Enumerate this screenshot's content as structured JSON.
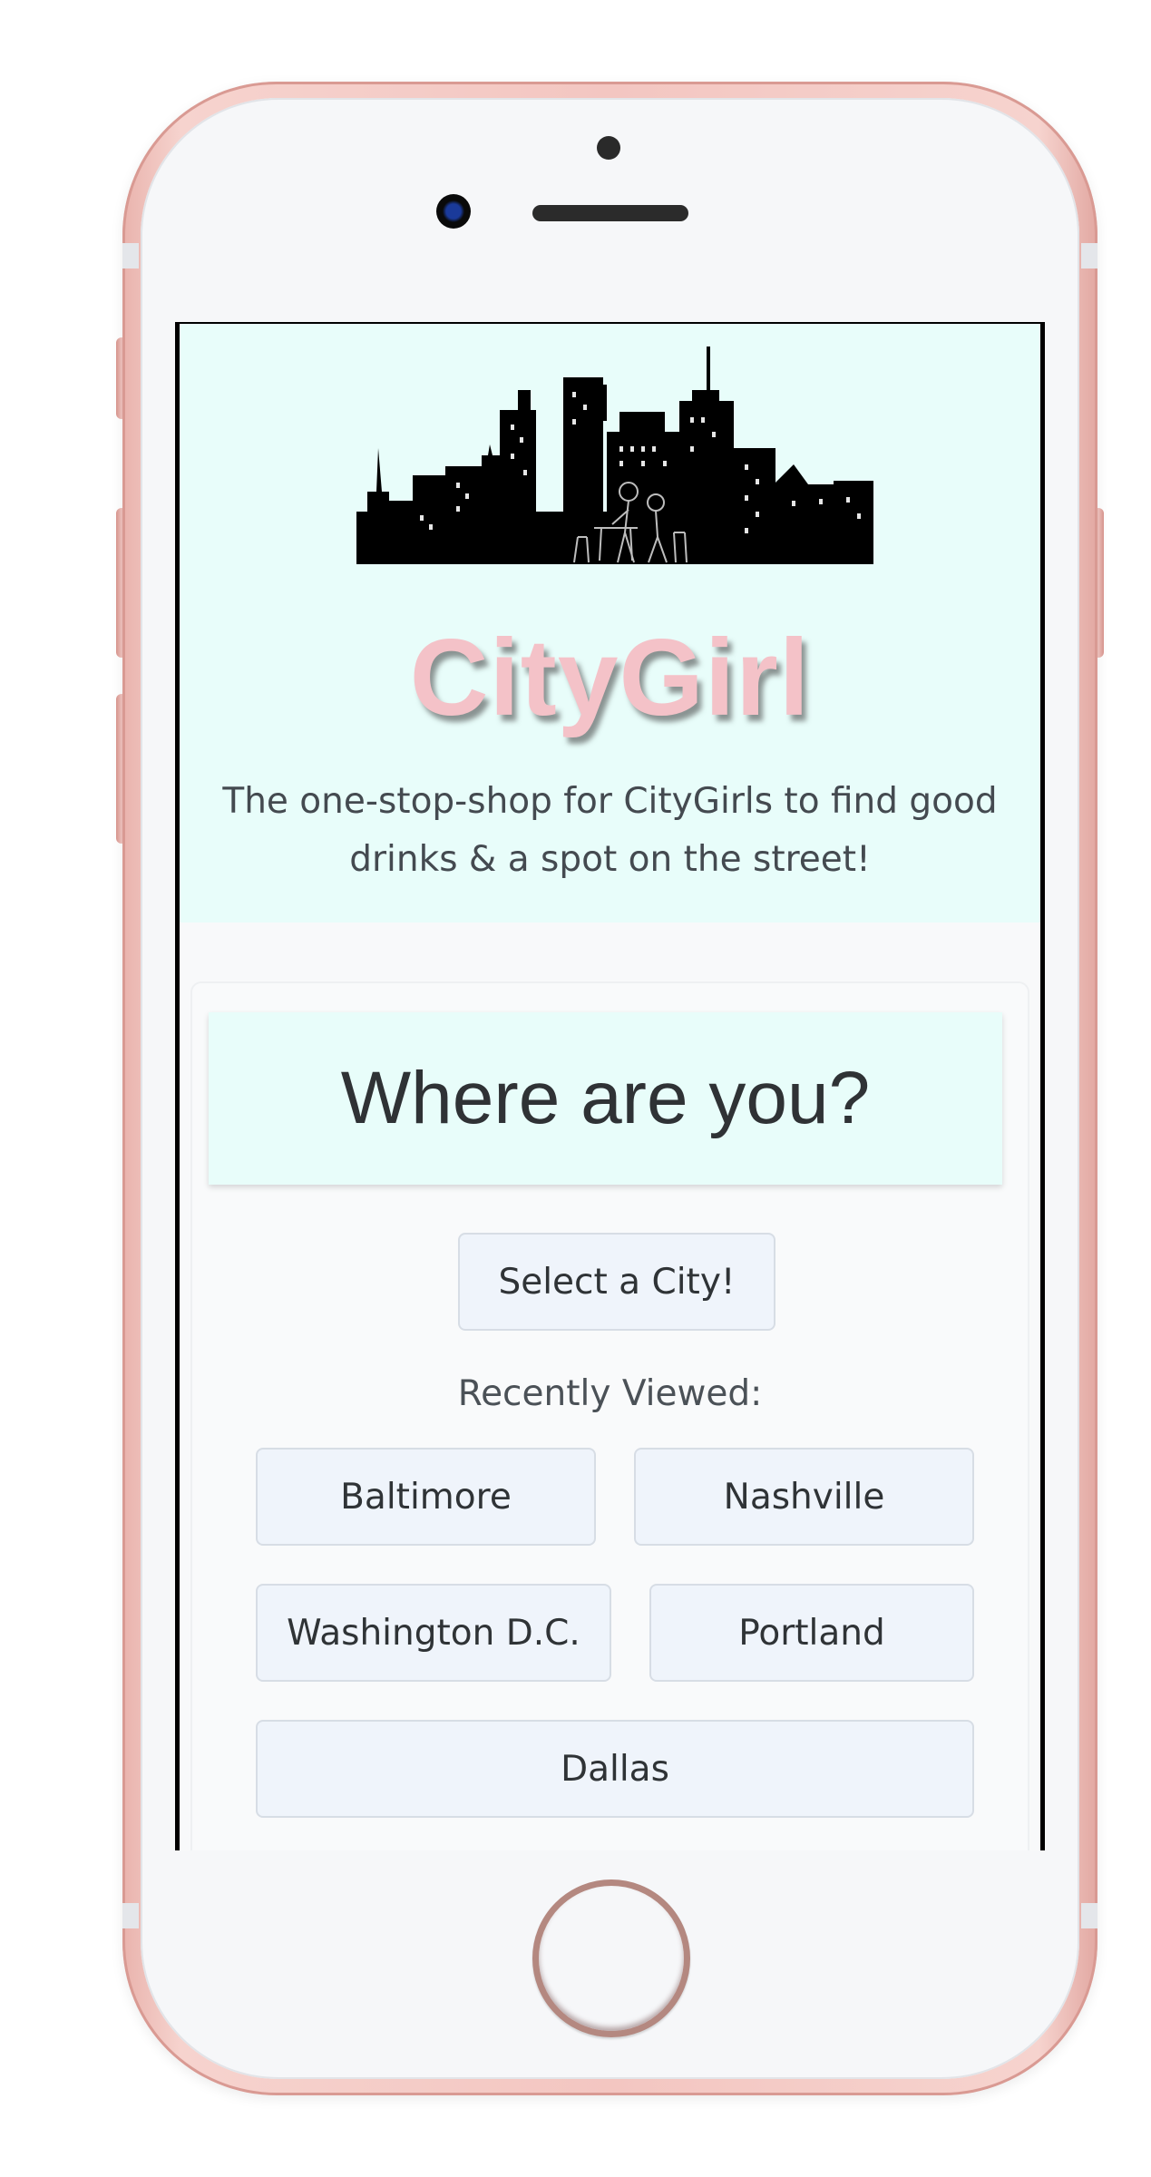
{
  "app": {
    "brand": "CityGirl",
    "tagline": "The one-stop-shop for CityGirls to find good drinks & a spot on the street!"
  },
  "location": {
    "heading": "Where are you?",
    "select_city_label": "Select a City!",
    "recent_label": "Recently Viewed:",
    "recent_cities": [
      "Baltimore",
      "Nashville",
      "Washington D.C.",
      "Portland",
      "Dallas"
    ]
  },
  "colors": {
    "hero_background": "#e8fdfa",
    "brand_text": "#f4c2c8",
    "button_background": "#eff4fb",
    "phone_shell": "rose-gold"
  },
  "icons": [
    "skyline-illustration",
    "front-camera-icon",
    "home-button"
  ]
}
